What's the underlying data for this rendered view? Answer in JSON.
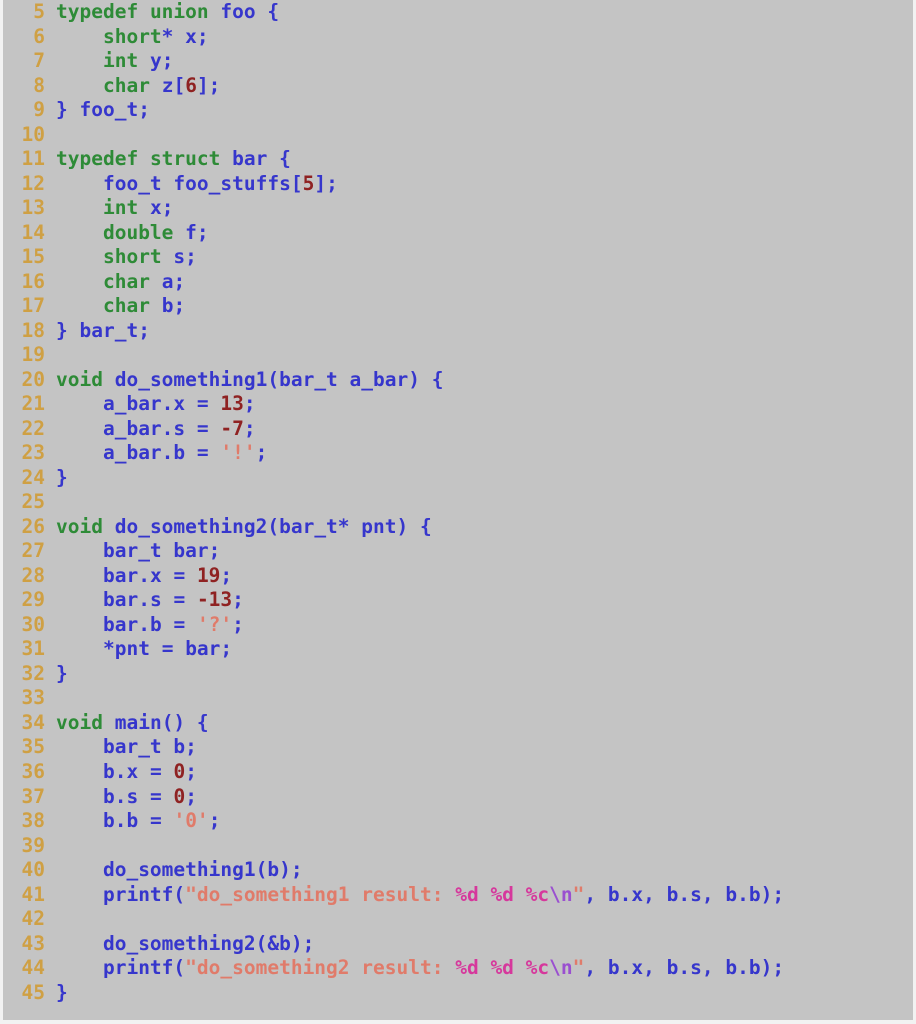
{
  "editor": {
    "language": "C",
    "background_color": "#c4c4c4",
    "gutter_color": "#cfa044",
    "first_visible_line": 5,
    "last_visible_line": 45,
    "colors": {
      "keyword": "#2e8b37",
      "identifier": "#3636cc",
      "number": "#8f2222",
      "string": "#e07b6a",
      "format_specifier": "#d6389c",
      "escape": "#9a4fd0"
    }
  },
  "lines": [
    {
      "n": "5",
      "tokens": [
        {
          "t": "typedef",
          "c": "kw"
        },
        {
          "t": " ",
          "c": "plain"
        },
        {
          "t": "union",
          "c": "kw"
        },
        {
          "t": " ",
          "c": "plain"
        },
        {
          "t": "foo",
          "c": "typ"
        },
        {
          "t": " {",
          "c": "punc"
        }
      ]
    },
    {
      "n": "6",
      "tokens": [
        {
          "t": "    ",
          "c": "plain"
        },
        {
          "t": "short",
          "c": "kw"
        },
        {
          "t": "*",
          "c": "punc"
        },
        {
          "t": " ",
          "c": "plain"
        },
        {
          "t": "x",
          "c": "id"
        },
        {
          "t": ";",
          "c": "punc"
        }
      ]
    },
    {
      "n": "7",
      "tokens": [
        {
          "t": "    ",
          "c": "plain"
        },
        {
          "t": "int",
          "c": "kw"
        },
        {
          "t": " ",
          "c": "plain"
        },
        {
          "t": "y",
          "c": "id"
        },
        {
          "t": ";",
          "c": "punc"
        }
      ]
    },
    {
      "n": "8",
      "tokens": [
        {
          "t": "    ",
          "c": "plain"
        },
        {
          "t": "char",
          "c": "kw"
        },
        {
          "t": " ",
          "c": "plain"
        },
        {
          "t": "z",
          "c": "id"
        },
        {
          "t": "[",
          "c": "punc"
        },
        {
          "t": "6",
          "c": "num"
        },
        {
          "t": "];",
          "c": "punc"
        }
      ]
    },
    {
      "n": "9",
      "tokens": [
        {
          "t": "} ",
          "c": "punc"
        },
        {
          "t": "foo_t",
          "c": "typ"
        },
        {
          "t": ";",
          "c": "punc"
        }
      ]
    },
    {
      "n": "10",
      "tokens": []
    },
    {
      "n": "11",
      "tokens": [
        {
          "t": "typedef",
          "c": "kw"
        },
        {
          "t": " ",
          "c": "plain"
        },
        {
          "t": "struct",
          "c": "kw"
        },
        {
          "t": " ",
          "c": "plain"
        },
        {
          "t": "bar",
          "c": "typ"
        },
        {
          "t": " {",
          "c": "punc"
        }
      ]
    },
    {
      "n": "12",
      "tokens": [
        {
          "t": "    ",
          "c": "plain"
        },
        {
          "t": "foo_t",
          "c": "typ"
        },
        {
          "t": " ",
          "c": "plain"
        },
        {
          "t": "foo_stuffs",
          "c": "id"
        },
        {
          "t": "[",
          "c": "punc"
        },
        {
          "t": "5",
          "c": "num"
        },
        {
          "t": "];",
          "c": "punc"
        }
      ]
    },
    {
      "n": "13",
      "tokens": [
        {
          "t": "    ",
          "c": "plain"
        },
        {
          "t": "int",
          "c": "kw"
        },
        {
          "t": " ",
          "c": "plain"
        },
        {
          "t": "x",
          "c": "id"
        },
        {
          "t": ";",
          "c": "punc"
        }
      ]
    },
    {
      "n": "14",
      "tokens": [
        {
          "t": "    ",
          "c": "plain"
        },
        {
          "t": "double",
          "c": "kw"
        },
        {
          "t": " ",
          "c": "plain"
        },
        {
          "t": "f",
          "c": "id"
        },
        {
          "t": ";",
          "c": "punc"
        }
      ]
    },
    {
      "n": "15",
      "tokens": [
        {
          "t": "    ",
          "c": "plain"
        },
        {
          "t": "short",
          "c": "kw"
        },
        {
          "t": " ",
          "c": "plain"
        },
        {
          "t": "s",
          "c": "id"
        },
        {
          "t": ";",
          "c": "punc"
        }
      ]
    },
    {
      "n": "16",
      "tokens": [
        {
          "t": "    ",
          "c": "plain"
        },
        {
          "t": "char",
          "c": "kw"
        },
        {
          "t": " ",
          "c": "plain"
        },
        {
          "t": "a",
          "c": "id"
        },
        {
          "t": ";",
          "c": "punc"
        }
      ]
    },
    {
      "n": "17",
      "tokens": [
        {
          "t": "    ",
          "c": "plain"
        },
        {
          "t": "char",
          "c": "kw"
        },
        {
          "t": " ",
          "c": "plain"
        },
        {
          "t": "b",
          "c": "id"
        },
        {
          "t": ";",
          "c": "punc"
        }
      ]
    },
    {
      "n": "18",
      "tokens": [
        {
          "t": "} ",
          "c": "punc"
        },
        {
          "t": "bar_t",
          "c": "typ"
        },
        {
          "t": ";",
          "c": "punc"
        }
      ]
    },
    {
      "n": "19",
      "tokens": []
    },
    {
      "n": "20",
      "tokens": [
        {
          "t": "void",
          "c": "kw"
        },
        {
          "t": " ",
          "c": "plain"
        },
        {
          "t": "do_something1",
          "c": "fn"
        },
        {
          "t": "(",
          "c": "punc"
        },
        {
          "t": "bar_t",
          "c": "typ"
        },
        {
          "t": " ",
          "c": "plain"
        },
        {
          "t": "a_bar",
          "c": "id"
        },
        {
          "t": ") {",
          "c": "punc"
        }
      ]
    },
    {
      "n": "21",
      "tokens": [
        {
          "t": "    ",
          "c": "plain"
        },
        {
          "t": "a_bar",
          "c": "id"
        },
        {
          "t": ".",
          "c": "punc"
        },
        {
          "t": "x",
          "c": "id"
        },
        {
          "t": " = ",
          "c": "op"
        },
        {
          "t": "13",
          "c": "num"
        },
        {
          "t": ";",
          "c": "punc"
        }
      ]
    },
    {
      "n": "22",
      "tokens": [
        {
          "t": "    ",
          "c": "plain"
        },
        {
          "t": "a_bar",
          "c": "id"
        },
        {
          "t": ".",
          "c": "punc"
        },
        {
          "t": "s",
          "c": "id"
        },
        {
          "t": " = ",
          "c": "op"
        },
        {
          "t": "-7",
          "c": "num"
        },
        {
          "t": ";",
          "c": "punc"
        }
      ]
    },
    {
      "n": "23",
      "tokens": [
        {
          "t": "    ",
          "c": "plain"
        },
        {
          "t": "a_bar",
          "c": "id"
        },
        {
          "t": ".",
          "c": "punc"
        },
        {
          "t": "b",
          "c": "id"
        },
        {
          "t": " = ",
          "c": "op"
        },
        {
          "t": "'!'",
          "c": "str"
        },
        {
          "t": ";",
          "c": "punc"
        }
      ]
    },
    {
      "n": "24",
      "tokens": [
        {
          "t": "}",
          "c": "punc"
        }
      ]
    },
    {
      "n": "25",
      "tokens": []
    },
    {
      "n": "26",
      "tokens": [
        {
          "t": "void",
          "c": "kw"
        },
        {
          "t": " ",
          "c": "plain"
        },
        {
          "t": "do_something2",
          "c": "fn"
        },
        {
          "t": "(",
          "c": "punc"
        },
        {
          "t": "bar_t",
          "c": "typ"
        },
        {
          "t": "*",
          "c": "punc"
        },
        {
          "t": " ",
          "c": "plain"
        },
        {
          "t": "pnt",
          "c": "id"
        },
        {
          "t": ") {",
          "c": "punc"
        }
      ]
    },
    {
      "n": "27",
      "tokens": [
        {
          "t": "    ",
          "c": "plain"
        },
        {
          "t": "bar_t",
          "c": "typ"
        },
        {
          "t": " ",
          "c": "plain"
        },
        {
          "t": "bar",
          "c": "id"
        },
        {
          "t": ";",
          "c": "punc"
        }
      ]
    },
    {
      "n": "28",
      "tokens": [
        {
          "t": "    ",
          "c": "plain"
        },
        {
          "t": "bar",
          "c": "id"
        },
        {
          "t": ".",
          "c": "punc"
        },
        {
          "t": "x",
          "c": "id"
        },
        {
          "t": " = ",
          "c": "op"
        },
        {
          "t": "19",
          "c": "num"
        },
        {
          "t": ";",
          "c": "punc"
        }
      ]
    },
    {
      "n": "29",
      "tokens": [
        {
          "t": "    ",
          "c": "plain"
        },
        {
          "t": "bar",
          "c": "id"
        },
        {
          "t": ".",
          "c": "punc"
        },
        {
          "t": "s",
          "c": "id"
        },
        {
          "t": " = ",
          "c": "op"
        },
        {
          "t": "-13",
          "c": "num"
        },
        {
          "t": ";",
          "c": "punc"
        }
      ]
    },
    {
      "n": "30",
      "tokens": [
        {
          "t": "    ",
          "c": "plain"
        },
        {
          "t": "bar",
          "c": "id"
        },
        {
          "t": ".",
          "c": "punc"
        },
        {
          "t": "b",
          "c": "id"
        },
        {
          "t": " = ",
          "c": "op"
        },
        {
          "t": "'?'",
          "c": "str"
        },
        {
          "t": ";",
          "c": "punc"
        }
      ]
    },
    {
      "n": "31",
      "tokens": [
        {
          "t": "    ",
          "c": "plain"
        },
        {
          "t": "*",
          "c": "punc"
        },
        {
          "t": "pnt",
          "c": "id"
        },
        {
          "t": " = ",
          "c": "op"
        },
        {
          "t": "bar",
          "c": "id"
        },
        {
          "t": ";",
          "c": "punc"
        }
      ]
    },
    {
      "n": "32",
      "tokens": [
        {
          "t": "}",
          "c": "punc"
        }
      ]
    },
    {
      "n": "33",
      "tokens": []
    },
    {
      "n": "34",
      "tokens": [
        {
          "t": "void",
          "c": "kw"
        },
        {
          "t": " ",
          "c": "plain"
        },
        {
          "t": "main",
          "c": "fn"
        },
        {
          "t": "() {",
          "c": "punc"
        }
      ]
    },
    {
      "n": "35",
      "tokens": [
        {
          "t": "    ",
          "c": "plain"
        },
        {
          "t": "bar_t",
          "c": "typ"
        },
        {
          "t": " ",
          "c": "plain"
        },
        {
          "t": "b",
          "c": "id"
        },
        {
          "t": ";",
          "c": "punc"
        }
      ]
    },
    {
      "n": "36",
      "tokens": [
        {
          "t": "    ",
          "c": "plain"
        },
        {
          "t": "b",
          "c": "id"
        },
        {
          "t": ".",
          "c": "punc"
        },
        {
          "t": "x",
          "c": "id"
        },
        {
          "t": " = ",
          "c": "op"
        },
        {
          "t": "0",
          "c": "num"
        },
        {
          "t": ";",
          "c": "punc"
        }
      ]
    },
    {
      "n": "37",
      "tokens": [
        {
          "t": "    ",
          "c": "plain"
        },
        {
          "t": "b",
          "c": "id"
        },
        {
          "t": ".",
          "c": "punc"
        },
        {
          "t": "s",
          "c": "id"
        },
        {
          "t": " = ",
          "c": "op"
        },
        {
          "t": "0",
          "c": "num"
        },
        {
          "t": ";",
          "c": "punc"
        }
      ]
    },
    {
      "n": "38",
      "tokens": [
        {
          "t": "    ",
          "c": "plain"
        },
        {
          "t": "b",
          "c": "id"
        },
        {
          "t": ".",
          "c": "punc"
        },
        {
          "t": "b",
          "c": "id"
        },
        {
          "t": " = ",
          "c": "op"
        },
        {
          "t": "'0'",
          "c": "str"
        },
        {
          "t": ";",
          "c": "punc"
        }
      ]
    },
    {
      "n": "39",
      "tokens": []
    },
    {
      "n": "40",
      "tokens": [
        {
          "t": "    ",
          "c": "plain"
        },
        {
          "t": "do_something1",
          "c": "fn"
        },
        {
          "t": "(",
          "c": "punc"
        },
        {
          "t": "b",
          "c": "id"
        },
        {
          "t": ");",
          "c": "punc"
        }
      ]
    },
    {
      "n": "41",
      "tokens": [
        {
          "t": "    ",
          "c": "plain"
        },
        {
          "t": "printf",
          "c": "fn"
        },
        {
          "t": "(",
          "c": "punc"
        },
        {
          "t": "\"do_something1 result: ",
          "c": "str"
        },
        {
          "t": "%d",
          "c": "fmt"
        },
        {
          "t": " ",
          "c": "str"
        },
        {
          "t": "%d",
          "c": "fmt"
        },
        {
          "t": " ",
          "c": "str"
        },
        {
          "t": "%c",
          "c": "fmt"
        },
        {
          "t": "\\n",
          "c": "esc"
        },
        {
          "t": "\"",
          "c": "str"
        },
        {
          "t": ", ",
          "c": "punc"
        },
        {
          "t": "b",
          "c": "id"
        },
        {
          "t": ".",
          "c": "punc"
        },
        {
          "t": "x",
          "c": "id"
        },
        {
          "t": ", ",
          "c": "punc"
        },
        {
          "t": "b",
          "c": "id"
        },
        {
          "t": ".",
          "c": "punc"
        },
        {
          "t": "s",
          "c": "id"
        },
        {
          "t": ", ",
          "c": "punc"
        },
        {
          "t": "b",
          "c": "id"
        },
        {
          "t": ".",
          "c": "punc"
        },
        {
          "t": "b",
          "c": "id"
        },
        {
          "t": ");",
          "c": "punc"
        }
      ]
    },
    {
      "n": "42",
      "tokens": []
    },
    {
      "n": "43",
      "tokens": [
        {
          "t": "    ",
          "c": "plain"
        },
        {
          "t": "do_something2",
          "c": "fn"
        },
        {
          "t": "(&",
          "c": "punc"
        },
        {
          "t": "b",
          "c": "id"
        },
        {
          "t": ");",
          "c": "punc"
        }
      ]
    },
    {
      "n": "44",
      "tokens": [
        {
          "t": "    ",
          "c": "plain"
        },
        {
          "t": "printf",
          "c": "fn"
        },
        {
          "t": "(",
          "c": "punc"
        },
        {
          "t": "\"do_something2 result: ",
          "c": "str"
        },
        {
          "t": "%d",
          "c": "fmt"
        },
        {
          "t": " ",
          "c": "str"
        },
        {
          "t": "%d",
          "c": "fmt"
        },
        {
          "t": " ",
          "c": "str"
        },
        {
          "t": "%c",
          "c": "fmt"
        },
        {
          "t": "\\n",
          "c": "esc"
        },
        {
          "t": "\"",
          "c": "str"
        },
        {
          "t": ", ",
          "c": "punc"
        },
        {
          "t": "b",
          "c": "id"
        },
        {
          "t": ".",
          "c": "punc"
        },
        {
          "t": "x",
          "c": "id"
        },
        {
          "t": ", ",
          "c": "punc"
        },
        {
          "t": "b",
          "c": "id"
        },
        {
          "t": ".",
          "c": "punc"
        },
        {
          "t": "s",
          "c": "id"
        },
        {
          "t": ", ",
          "c": "punc"
        },
        {
          "t": "b",
          "c": "id"
        },
        {
          "t": ".",
          "c": "punc"
        },
        {
          "t": "b",
          "c": "id"
        },
        {
          "t": ");",
          "c": "punc"
        }
      ]
    },
    {
      "n": "45",
      "tokens": [
        {
          "t": "}",
          "c": "punc"
        }
      ]
    }
  ],
  "source_text": "typedef union foo {\n    short* x;\n    int y;\n    char z[6];\n} foo_t;\n\ntypedef struct bar {\n    foo_t foo_stuffs[5];\n    int x;\n    double f;\n    short s;\n    char a;\n    char b;\n} bar_t;\n\nvoid do_something1(bar_t a_bar) {\n    a_bar.x = 13;\n    a_bar.s = -7;\n    a_bar.b = '!';\n}\n\nvoid do_something2(bar_t* pnt) {\n    bar_t bar;\n    bar.x = 19;\n    bar.s = -13;\n    bar.b = '?';\n    *pnt = bar;\n}\n\nvoid main() {\n    bar_t b;\n    b.x = 0;\n    b.s = 0;\n    b.b = '0';\n\n    do_something1(b);\n    printf(\"do_something1 result: %d %d %c\\n\", b.x, b.s, b.b);\n\n    do_something2(&b);\n    printf(\"do_something2 result: %d %d %c\\n\", b.x, b.s, b.b);\n}"
}
